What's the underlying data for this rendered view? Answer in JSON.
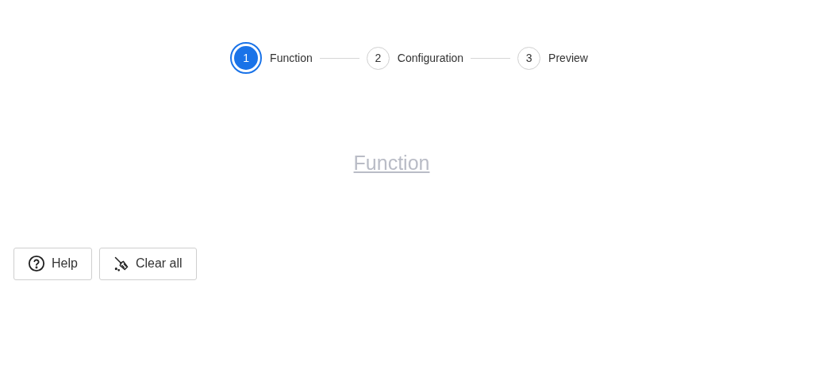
{
  "steps": [
    {
      "number": "1",
      "label": "Function",
      "selected": true
    },
    {
      "number": "2",
      "label": "Configuration",
      "selected": false
    },
    {
      "number": "3",
      "label": "Preview",
      "selected": false
    }
  ],
  "heading": "Function",
  "buttons": [
    {
      "kind": "help",
      "label": "Help"
    },
    {
      "kind": "clear",
      "label": "Clear all"
    }
  ]
}
